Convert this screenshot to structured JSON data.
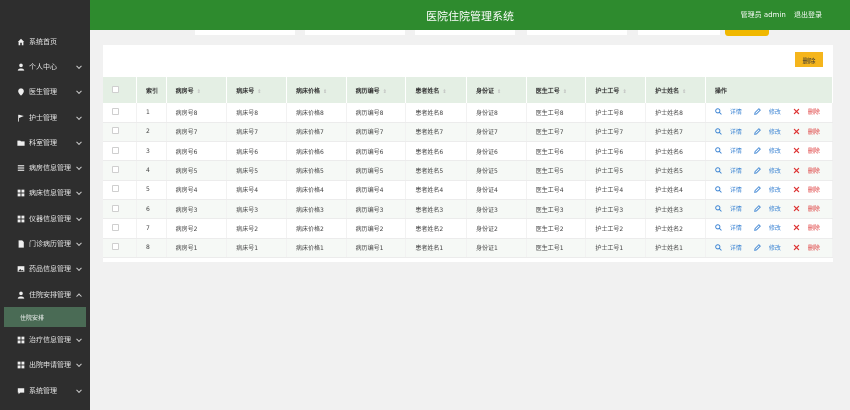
{
  "app": {
    "title": "医院住院管理系统",
    "user_label": "管理员 admin",
    "logout_label": "退出登录"
  },
  "sidebar": {
    "items": [
      {
        "label": "系统首页",
        "icon": "home-icon",
        "chevron": false
      },
      {
        "label": "个人中心",
        "icon": "user-icon",
        "chevron": true
      },
      {
        "label": "医生管理",
        "icon": "pin-icon",
        "chevron": true
      },
      {
        "label": "护士管理",
        "icon": "flag-icon",
        "chevron": true
      },
      {
        "label": "科室管理",
        "icon": "folder-icon",
        "chevron": true
      },
      {
        "label": "病房信息管理",
        "icon": "list-icon",
        "chevron": true
      },
      {
        "label": "病床信息管理",
        "icon": "grid-icon",
        "chevron": true
      },
      {
        "label": "仪器信息管理",
        "icon": "grid-icon",
        "chevron": true
      },
      {
        "label": "门诊病历管理",
        "icon": "doc-icon",
        "chevron": true
      },
      {
        "label": "药品信息管理",
        "icon": "image-icon",
        "chevron": true
      },
      {
        "label": "住院安排管理",
        "icon": "user-icon",
        "chevron": true,
        "expanded": true
      },
      {
        "label": "治疗信息管理",
        "icon": "grid-icon",
        "chevron": true
      },
      {
        "label": "出院申请管理",
        "icon": "grid-icon",
        "chevron": true
      },
      {
        "label": "系统管理",
        "icon": "chat-icon",
        "chevron": true
      }
    ],
    "sub_item": "住院安排"
  },
  "toolbar": {
    "delete_label": "删除"
  },
  "table": {
    "headers": [
      "索引",
      "病房号",
      "病床号",
      "病床价格",
      "病历编号",
      "患者姓名",
      "身份证",
      "医生工号",
      "护士工号",
      "护士姓名",
      "操作"
    ],
    "rows": [
      [
        "1",
        "病房号8",
        "病床号8",
        "病床价格8",
        "病历编号8",
        "患者姓名8",
        "身份证8",
        "医生工号8",
        "护士工号8",
        "护士姓名8"
      ],
      [
        "2",
        "病房号7",
        "病床号7",
        "病床价格7",
        "病历编号7",
        "患者姓名7",
        "身份证7",
        "医生工号7",
        "护士工号7",
        "护士姓名7"
      ],
      [
        "3",
        "病房号6",
        "病床号6",
        "病床价格6",
        "病历编号6",
        "患者姓名6",
        "身份证6",
        "医生工号6",
        "护士工号6",
        "护士姓名6"
      ],
      [
        "4",
        "病房号5",
        "病床号5",
        "病床价格5",
        "病历编号5",
        "患者姓名5",
        "身份证5",
        "医生工号5",
        "护士工号5",
        "护士姓名5"
      ],
      [
        "5",
        "病房号4",
        "病床号4",
        "病床价格4",
        "病历编号4",
        "患者姓名4",
        "身份证4",
        "医生工号4",
        "护士工号4",
        "护士姓名4"
      ],
      [
        "6",
        "病房号3",
        "病床号3",
        "病床价格3",
        "病历编号3",
        "患者姓名3",
        "身份证3",
        "医生工号3",
        "护士工号3",
        "护士姓名3"
      ],
      [
        "7",
        "病房号2",
        "病床号2",
        "病床价格2",
        "病历编号2",
        "患者姓名2",
        "身份证2",
        "医生工号2",
        "护士工号2",
        "护士姓名2"
      ],
      [
        "8",
        "病房号1",
        "病床号1",
        "病床价格1",
        "病历编号1",
        "患者姓名1",
        "身份证1",
        "医生工号1",
        "护士工号1",
        "护士姓名1"
      ]
    ],
    "actions": {
      "detail": "详情",
      "edit": "修改",
      "delete": "删除"
    }
  },
  "colors": {
    "header_green": "#2e8b2e",
    "sidebar_bg": "#2e2e2e",
    "accent_yellow": "#f5b51c",
    "link_blue": "#3a83d3",
    "delete_red": "#d33333"
  }
}
